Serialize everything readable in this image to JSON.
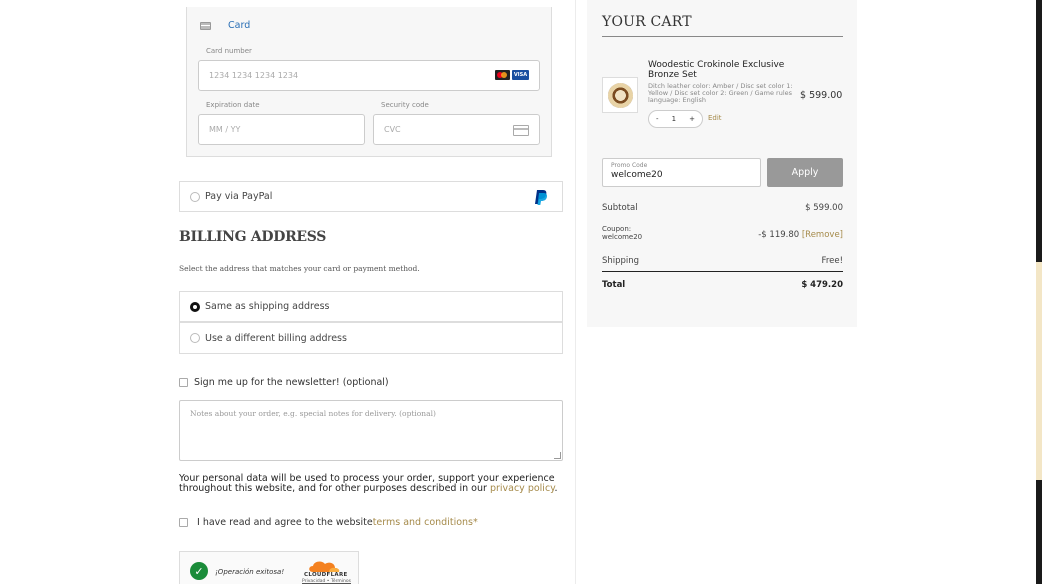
{
  "payment": {
    "card_label": "Card",
    "card_number_label": "Card number",
    "card_number_placeholder": "1234 1234 1234 1234",
    "expiration_label": "Expiration date",
    "expiration_placeholder": "MM / YY",
    "security_label": "Security code",
    "security_placeholder": "CVC",
    "visa_text": "VISA",
    "paypal_label": "Pay via PayPal"
  },
  "billing": {
    "title": "BILLING ADDRESS",
    "subtitle": "Select the address that matches your card or payment method.",
    "options": [
      "Same as shipping address",
      "Use a different billing address"
    ],
    "selected_index": 0
  },
  "newsletter_label": "Sign me up for the newsletter! (optional)",
  "notes_placeholder": "Notes about your order, e.g. special notes for delivery. (optional)",
  "privacy": {
    "text": "Your personal data will be used to process your order, support your experience throughout this website, and for other purposes described in our ",
    "link": "privacy policy",
    "suffix": "."
  },
  "terms": {
    "text": "I have read and agree to the website ",
    "link": "terms and conditions",
    "required_mark": "*"
  },
  "captcha": {
    "status": "¡Operación exitosa!",
    "brand": "CLOUDFLARE",
    "links": "Privacidad • Términos"
  },
  "cart": {
    "title": "YOUR CART",
    "item": {
      "name": "Woodestic Crokinole Exclusive Bronze Set",
      "meta": "Ditch leather color: Amber / Disc set color 1: Yellow / Disc set color 2: Green / Game rules language: English",
      "price": "$ 599.00",
      "quantity": "1",
      "minus": "-",
      "plus": "+",
      "edit": "Edit"
    },
    "promo_label": "Promo Code",
    "promo_value": "welcome20",
    "apply_label": "Apply",
    "subtotal_label": "Subtotal",
    "subtotal_value": "$ 599.00",
    "coupon_label": "Coupon:",
    "coupon_code": "welcome20",
    "coupon_value": "-$ 119.80",
    "remove_label": "[Remove]",
    "shipping_label": "Shipping",
    "shipping_value": "Free!",
    "total_label": "Total",
    "total_value": "$ 479.20"
  },
  "colors": {
    "accent_gold": "#a58a4a",
    "card_blue": "#2a6fb5",
    "apply_gray": "#999999"
  }
}
